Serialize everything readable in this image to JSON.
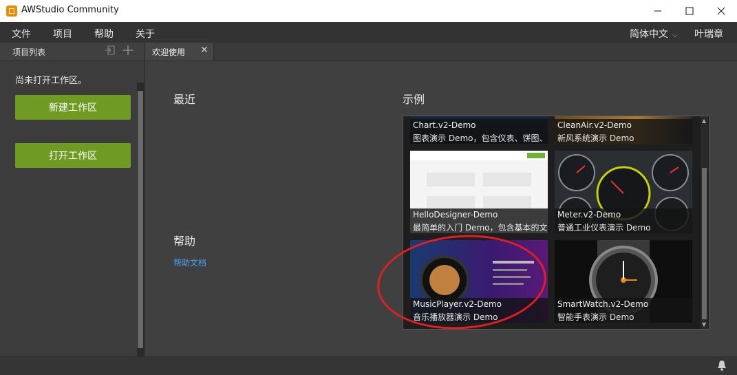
{
  "window": {
    "title": "AWStudio Community",
    "controls": {
      "minimize": "—",
      "maximize": "☐",
      "close": "✕"
    }
  },
  "menu": {
    "items": [
      "文件",
      "项目",
      "帮助",
      "关于"
    ],
    "language": "简体中文",
    "user": "叶瑞章"
  },
  "sidebar": {
    "header": "项目列表",
    "status": "尚未打开工作区。",
    "new_workspace": "新建工作区",
    "open_workspace": "打开工作区"
  },
  "tabs": [
    {
      "label": "欢迎使用"
    }
  ],
  "welcome": {
    "recent_title": "最近",
    "examples_title": "示例",
    "help_title": "帮助",
    "help_link": "帮助文档"
  },
  "examples": [
    {
      "name": "Chart.v2-Demo",
      "desc": "图表演示  Demo，包含仪表、饼图、...",
      "icon": "chart-thumbnail"
    },
    {
      "name": "CleanAir.v2-Demo",
      "desc": "新风系统演示  Demo",
      "icon": "cleanair-thumbnail"
    },
    {
      "name": "HelloDesigner-Demo",
      "desc": "最简单的入门  Demo，包含基本的文...",
      "icon": "hellodesigner-thumbnail"
    },
    {
      "name": "Meter.v2-Demo",
      "desc": "普通工业仪表演示  Demo",
      "icon": "meter-thumbnail"
    },
    {
      "name": "MusicPlayer.v2-Demo",
      "desc": "音乐播放器演示  Demo",
      "icon": "musicplayer-thumbnail"
    },
    {
      "name": "SmartWatch.v2-Demo",
      "desc": "智能手表演示  Demo",
      "icon": "smartwatch-thumbnail"
    }
  ],
  "colors": {
    "accent_green": "#6f9b23",
    "link_blue": "#4aa0e8",
    "annotation_red": "#e02020"
  }
}
